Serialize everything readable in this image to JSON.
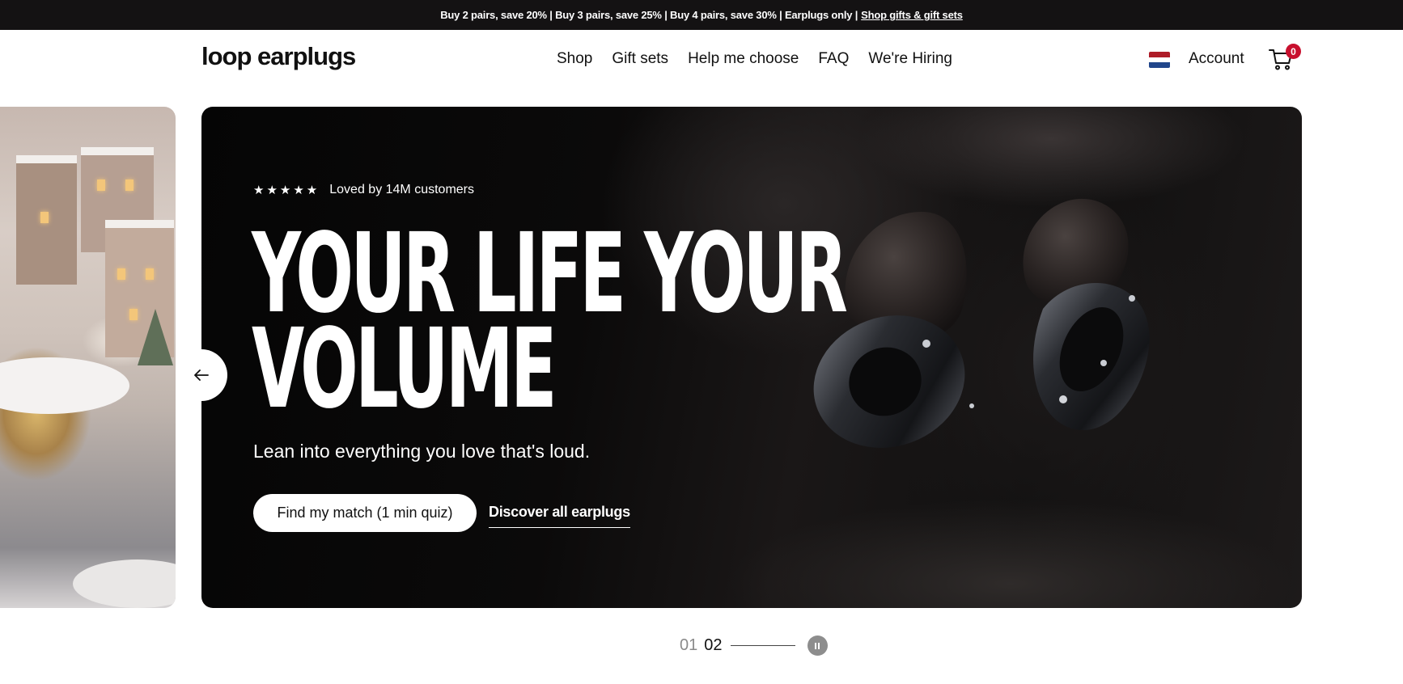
{
  "announcement": {
    "text": "Buy 2 pairs, save 20% | Buy 3 pairs, save 25% | Buy 4 pairs, save 30% | Earplugs only |",
    "link": "Shop gifts & gift sets"
  },
  "header": {
    "logo": "loop earplugs",
    "nav": [
      "Shop",
      "Gift sets",
      "Help me choose",
      "FAQ",
      "We're Hiring"
    ],
    "account": "Account",
    "cart_count": "0",
    "flag_colors": [
      "#ae1c28",
      "#ffffff",
      "#21468b"
    ]
  },
  "hero": {
    "stars": "★★★★★",
    "rating_text": "Loved by 14M customers",
    "headline_line1": "YOUR LIFE YOUR",
    "headline_line2": "VOLUME",
    "subline": "Lean into everything you love that's loud.",
    "primary_cta": "Find my match (1 min quiz)",
    "secondary_cta": "Discover all earplugs"
  },
  "pager": {
    "slide_a": "01",
    "slide_b": "02"
  },
  "colors": {
    "announcement_bg": "#141213",
    "badge": "#c8102e",
    "hero_bg": "#0b0a0a"
  }
}
